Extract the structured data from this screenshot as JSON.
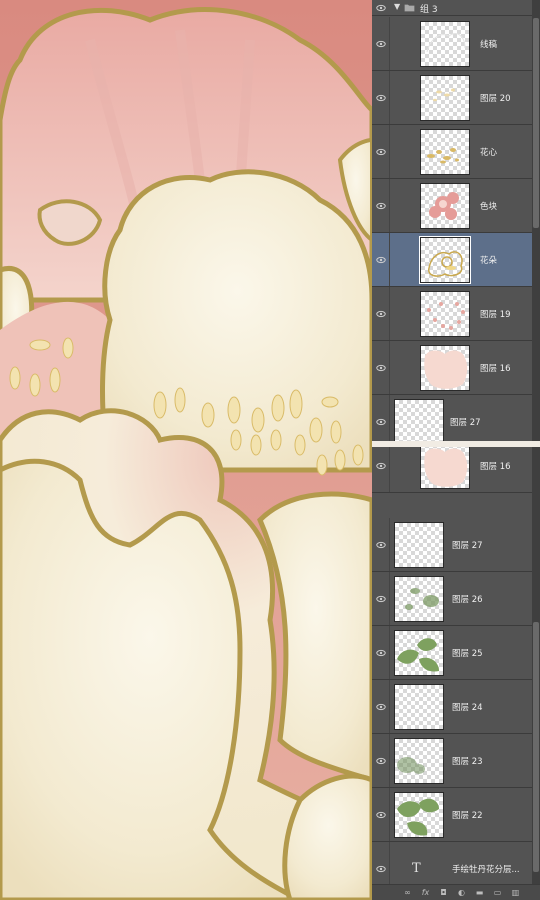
{
  "panel_top": {
    "group": {
      "name": "组 3",
      "expanded": true
    },
    "layers": [
      {
        "name": "线稿",
        "thumb": "lineart-thumb",
        "selected": false
      },
      {
        "name": "图层 20",
        "thumb": "faint-yellow-thumb",
        "selected": false
      },
      {
        "name": "花心",
        "thumb": "stamen-thumb",
        "selected": false
      },
      {
        "name": "色块",
        "thumb": "pink-flower-thumb",
        "selected": false
      },
      {
        "name": "花朵",
        "thumb": "yellow-flower-thumb",
        "selected": true
      },
      {
        "name": "图层 19",
        "thumb": "pink-dots-thumb",
        "selected": false
      },
      {
        "name": "图层 16",
        "thumb": "pink-blob-thumb",
        "selected": false
      },
      {
        "name": "图层 27",
        "thumb": "empty-thumb",
        "selected": false
      }
    ]
  },
  "panel_bottom": {
    "layers": [
      {
        "name": "图层 16",
        "thumb": "pink-blob-thumb"
      },
      {
        "name": "图层 27",
        "thumb": "empty-thumb"
      },
      {
        "name": "图层 26",
        "thumb": "green-soft-thumb"
      },
      {
        "name": "图层 25",
        "thumb": "green-leaves-thumb"
      },
      {
        "name": "图层 24",
        "thumb": "empty-thumb"
      },
      {
        "name": "图层 23",
        "thumb": "green-blur-thumb"
      },
      {
        "name": "图层 22",
        "thumb": "green-leaves-2-thumb"
      },
      {
        "name": "手绘牡丹花分层...",
        "thumb": "text-layer-icon"
      }
    ],
    "toolbar_icons": [
      "link-icon",
      "fx-icon",
      "mask-icon",
      "adjustment-icon",
      "folder-icon",
      "new-layer-icon",
      "trash-icon"
    ],
    "toolbar_labels": [
      "∞",
      "fx",
      "◘",
      "◐",
      "▬",
      "▭",
      "▥"
    ]
  },
  "colors": {
    "panel_bg": "#535353",
    "selected_row": "#5d6f8a",
    "petal_cream": "#f3ecd4",
    "petal_pink": "#e4a49c",
    "outline_gold": "#b39a4c"
  }
}
